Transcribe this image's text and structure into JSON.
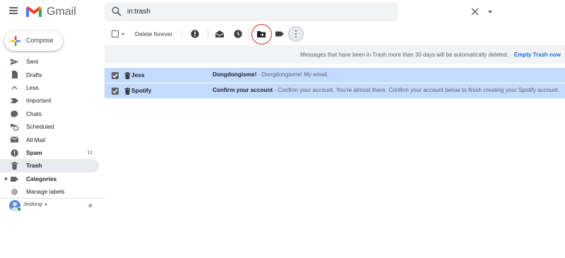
{
  "app": {
    "name": "Gmail",
    "brand_colors": [
      "#ea4335",
      "#4285f4",
      "#34a853",
      "#fbbc04"
    ]
  },
  "search": {
    "value": "in:trash"
  },
  "compose": {
    "label": "Compose"
  },
  "sidebar": {
    "items": [
      {
        "label": "Sent",
        "icon": "send-icon",
        "bold": false,
        "count": ""
      },
      {
        "label": "Drafts",
        "icon": "draft-icon",
        "bold": false,
        "count": ""
      },
      {
        "label": "Less",
        "icon": "chevron-up-icon",
        "bold": false,
        "count": ""
      },
      {
        "label": "Important",
        "icon": "important-icon",
        "bold": false,
        "count": ""
      },
      {
        "label": "Chats",
        "icon": "chat-icon",
        "bold": false,
        "count": ""
      },
      {
        "label": "Scheduled",
        "icon": "scheduled-icon",
        "bold": false,
        "count": ""
      },
      {
        "label": "All Mail",
        "icon": "all-mail-icon",
        "bold": false,
        "count": ""
      },
      {
        "label": "Spam",
        "icon": "spam-icon",
        "bold": true,
        "count": "11"
      },
      {
        "label": "Trash",
        "icon": "trash-icon",
        "bold": true,
        "count": "",
        "active": true
      },
      {
        "label": "Categories",
        "icon": "label-icon",
        "bold": true,
        "count": ""
      },
      {
        "label": "Manage labels",
        "icon": "gear-icon",
        "bold": false,
        "count": ""
      }
    ]
  },
  "user": {
    "name": "Jindong"
  },
  "toolbar": {
    "delete_forever_label": "Delete forever"
  },
  "infobar": {
    "message": "Messages that have been in Trash more than 30 days will be automatically deleted.",
    "action_label": "Empty Trash now"
  },
  "messages": [
    {
      "sender": "Jess",
      "subject": "Dongdongisme!",
      "snippet": " - Dongdongisme! My email."
    },
    {
      "sender": "Spotify",
      "subject": "Confirm your account",
      "snippet": " - Confirm your account. You're almost there. Confirm your account below to finish creating your Spotify account."
    }
  ]
}
